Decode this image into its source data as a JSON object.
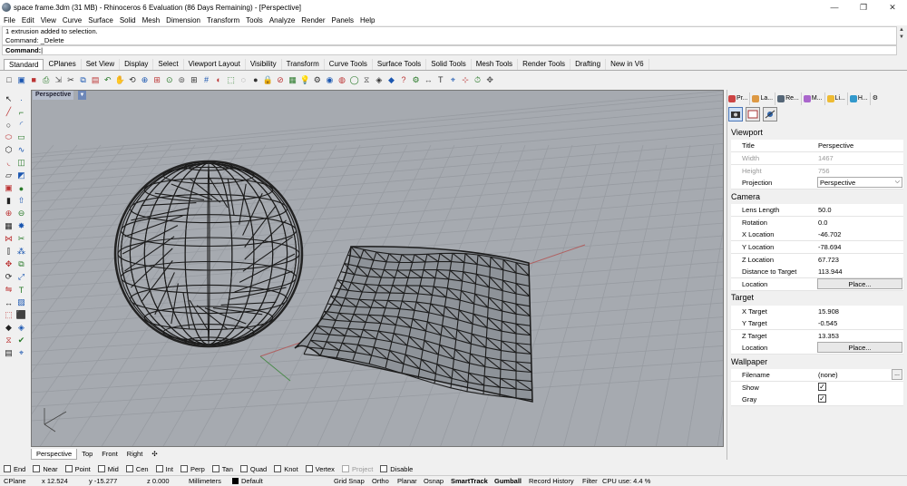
{
  "window": {
    "title": "space frame.3dm (31 MB) - Rhinoceros 6 Evaluation (86 Days Remaining) - [Perspective]"
  },
  "menu": [
    "File",
    "Edit",
    "View",
    "Curve",
    "Surface",
    "Solid",
    "Mesh",
    "Dimension",
    "Transform",
    "Tools",
    "Analyze",
    "Render",
    "Panels",
    "Help"
  ],
  "command": {
    "history": [
      "1 extrusion added to selection.",
      "Command: _Delete"
    ],
    "prompt": "Command:"
  },
  "tabs": [
    "Standard",
    "CPlanes",
    "Set View",
    "Display",
    "Select",
    "Viewport Layout",
    "Visibility",
    "Transform",
    "Curve Tools",
    "Surface Tools",
    "Solid Tools",
    "Mesh Tools",
    "Render Tools",
    "Drafting",
    "New in V6"
  ],
  "viewport": {
    "title": "Perspective"
  },
  "viewport_tabs": [
    "Perspective",
    "Top",
    "Front",
    "Right"
  ],
  "osnap": [
    {
      "label": "End",
      "enabled": true
    },
    {
      "label": "Near",
      "enabled": true
    },
    {
      "label": "Point",
      "enabled": true
    },
    {
      "label": "Mid",
      "enabled": true
    },
    {
      "label": "Cen",
      "enabled": true
    },
    {
      "label": "Int",
      "enabled": true
    },
    {
      "label": "Perp",
      "enabled": true
    },
    {
      "label": "Tan",
      "enabled": true
    },
    {
      "label": "Quad",
      "enabled": true
    },
    {
      "label": "Knot",
      "enabled": true
    },
    {
      "label": "Vertex",
      "enabled": true
    },
    {
      "label": "Project",
      "enabled": false
    },
    {
      "label": "Disable",
      "enabled": true
    }
  ],
  "status": {
    "cplane": "CPlane",
    "x": "x 12.524",
    "y": "y -15.277",
    "z": "z 0.000",
    "units": "Millimeters",
    "layer": "Default",
    "grid_snap": "Grid Snap",
    "ortho": "Ortho",
    "planar": "Planar",
    "osnap": "Osnap",
    "smarttrack": "SmartTrack",
    "gumball": "Gumball",
    "record_history": "Record History",
    "filter": "Filter",
    "cpu": "CPU use: 4.4 %"
  },
  "panel": {
    "tabs": [
      "Pr...",
      "La...",
      "Re...",
      "M...",
      "Li...",
      "H..."
    ],
    "viewport": {
      "heading": "Viewport",
      "title_label": "Title",
      "title_value": "Perspective",
      "width_label": "Width",
      "width_value": "1467",
      "height_label": "Height",
      "height_value": "756",
      "projection_label": "Projection",
      "projection_value": "Perspective"
    },
    "camera": {
      "heading": "Camera",
      "lens_label": "Lens Length",
      "lens_value": "50.0",
      "rotation_label": "Rotation",
      "rotation_value": "0.0",
      "xloc_label": "X Location",
      "xloc_value": "-46.702",
      "yloc_label": "Y Location",
      "yloc_value": "-78.694",
      "zloc_label": "Z Location",
      "zloc_value": "67.723",
      "dist_label": "Distance to Target",
      "dist_value": "113.944",
      "location_label": "Location",
      "place_label": "Place..."
    },
    "target": {
      "heading": "Target",
      "xt_label": "X Target",
      "xt_value": "15.908",
      "yt_label": "Y Target",
      "yt_value": "-0.545",
      "zt_label": "Z Target",
      "zt_value": "13.353",
      "location_label": "Location",
      "place_label": "Place..."
    },
    "wallpaper": {
      "heading": "Wallpaper",
      "filename_label": "Filename",
      "filename_value": "(none)",
      "more_label": "...",
      "show_label": "Show",
      "show_checked": true,
      "gray_label": "Gray",
      "gray_checked": true
    }
  }
}
